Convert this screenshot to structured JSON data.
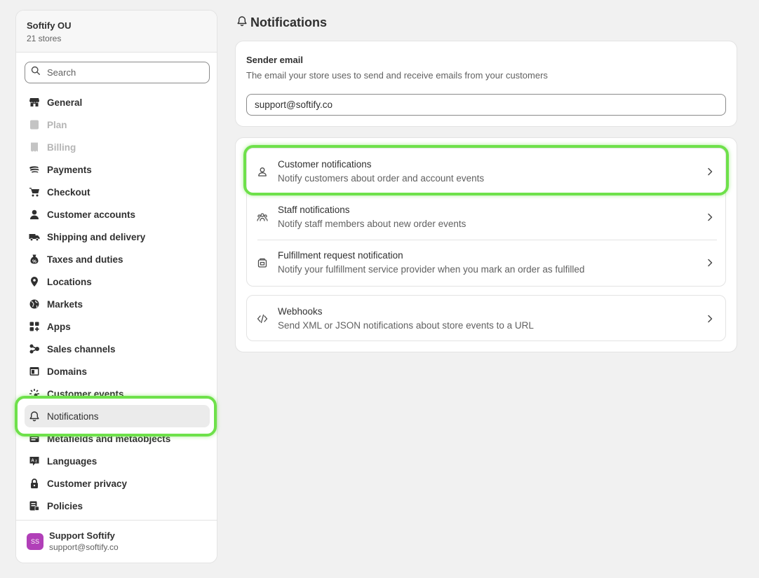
{
  "sidebar": {
    "org_name": "Softify OU",
    "org_sub": "21 stores",
    "search_placeholder": "Search",
    "items": [
      {
        "label": "General",
        "icon": "store-icon",
        "state": "normal"
      },
      {
        "label": "Plan",
        "icon": "plan-icon",
        "state": "disabled"
      },
      {
        "label": "Billing",
        "icon": "billing-icon",
        "state": "disabled"
      },
      {
        "label": "Payments",
        "icon": "payments-icon",
        "state": "normal"
      },
      {
        "label": "Checkout",
        "icon": "cart-icon",
        "state": "normal"
      },
      {
        "label": "Customer accounts",
        "icon": "person-icon",
        "state": "normal"
      },
      {
        "label": "Shipping and delivery",
        "icon": "truck-icon",
        "state": "normal"
      },
      {
        "label": "Taxes and duties",
        "icon": "tax-icon",
        "state": "normal"
      },
      {
        "label": "Locations",
        "icon": "location-pin-icon",
        "state": "normal"
      },
      {
        "label": "Markets",
        "icon": "globe-icon",
        "state": "normal"
      },
      {
        "label": "Apps",
        "icon": "apps-icon",
        "state": "normal"
      },
      {
        "label": "Sales channels",
        "icon": "channels-icon",
        "state": "normal"
      },
      {
        "label": "Domains",
        "icon": "domain-icon",
        "state": "normal"
      },
      {
        "label": "Customer events",
        "icon": "events-icon",
        "state": "normal"
      },
      {
        "label": "Notifications",
        "icon": "bell-icon",
        "state": "active"
      },
      {
        "label": "Metafields and metaobjects",
        "icon": "metafields-icon",
        "state": "normal"
      },
      {
        "label": "Languages",
        "icon": "language-icon",
        "state": "normal"
      },
      {
        "label": "Customer privacy",
        "icon": "lock-icon",
        "state": "normal"
      },
      {
        "label": "Policies",
        "icon": "policy-icon",
        "state": "normal"
      }
    ],
    "user": {
      "initials": "SS",
      "name": "Support Softify",
      "email": "support@softify.co",
      "avatar_color": "#b13fb8"
    }
  },
  "main": {
    "title": "Notifications",
    "sender": {
      "title": "Sender email",
      "subtitle": "The email your store uses to send and receive emails from your customers",
      "value": "support@softify.co"
    },
    "rows": [
      {
        "title": "Customer notifications",
        "subtitle": "Notify customers about order and account events",
        "icon": "person-icon"
      },
      {
        "title": "Staff notifications",
        "subtitle": "Notify staff members about new order events",
        "icon": "staff-icon"
      },
      {
        "title": "Fulfillment request notification",
        "subtitle": "Notify your fulfillment service provider when you mark an order as fulfilled",
        "icon": "fulfillment-icon"
      }
    ],
    "webhooks": {
      "title": "Webhooks",
      "subtitle": "Send XML or JSON notifications about store events to a URL",
      "icon": "code-icon"
    }
  },
  "colors": {
    "highlight": "#6ee14a",
    "background": "#f1f1f1",
    "avatar": "#b13fb8"
  }
}
